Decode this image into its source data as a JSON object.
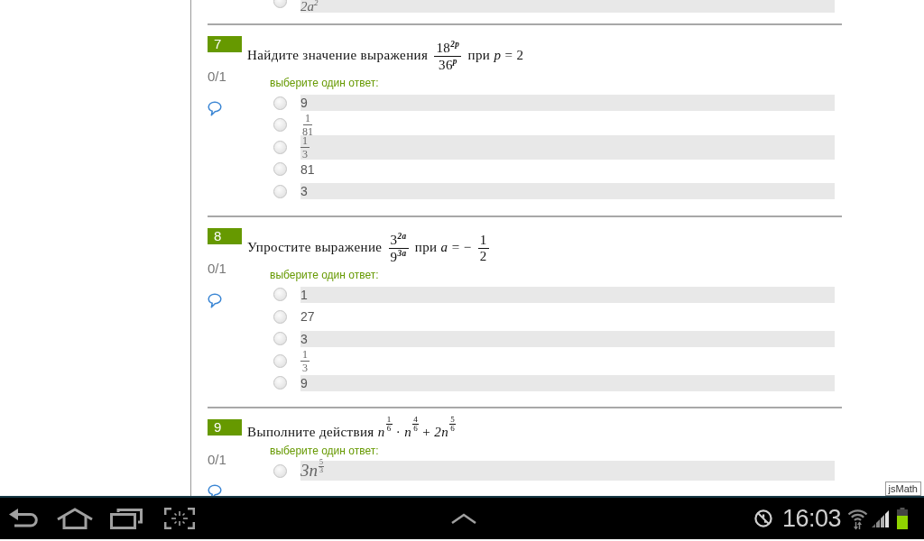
{
  "previous_question": {
    "options": [
      {
        "kind": "math",
        "text": "2a$^{2}$",
        "selected": false
      }
    ]
  },
  "questions": [
    {
      "number": "7",
      "score": "0/1",
      "prompt": [
        {
          "kind": "text",
          "text": "Найдите значение выражения"
        },
        {
          "kind": "frac",
          "num": "18$^{2p}$",
          "den": "36$^{p}$"
        },
        {
          "kind": "text",
          "text": "при *p* = 2"
        }
      ],
      "answer_prompt": "выберите один ответ:",
      "options": [
        {
          "kind": "text",
          "text": "9",
          "selected": false
        },
        {
          "kind": "frac",
          "num": "1",
          "den": "81",
          "selected": false
        },
        {
          "kind": "frac",
          "num": "1",
          "den": "3",
          "selected": false
        },
        {
          "kind": "text",
          "text": "81",
          "selected": false
        },
        {
          "kind": "text",
          "text": "3",
          "selected": false
        }
      ]
    },
    {
      "number": "8",
      "score": "0/1",
      "prompt": [
        {
          "kind": "text",
          "text": "Упростите выражение"
        },
        {
          "kind": "frac",
          "num": "3$^{2a}$",
          "den": "9$^{3a}$"
        },
        {
          "kind": "text",
          "text": "при *a* = −"
        },
        {
          "kind": "frac",
          "num": "1",
          "den": "2"
        }
      ],
      "answer_prompt": "выберите один ответ:",
      "options": [
        {
          "kind": "text",
          "text": "1",
          "selected": false
        },
        {
          "kind": "text",
          "text": "27",
          "selected": false
        },
        {
          "kind": "text",
          "text": "3",
          "selected": false
        },
        {
          "kind": "frac",
          "num": "1",
          "den": "3",
          "selected": false
        },
        {
          "kind": "text",
          "text": "9",
          "selected": false
        }
      ]
    },
    {
      "number": "9",
      "score": "0/1",
      "prompt": [
        {
          "kind": "text",
          "text": "Выполните действия"
        },
        {
          "kind": "pow",
          "base": "n",
          "num": "1",
          "den": "6"
        },
        {
          "kind": "text",
          "text": "·"
        },
        {
          "kind": "pow",
          "base": "n",
          "num": "4",
          "den": "6"
        },
        {
          "kind": "text",
          "text": "+"
        },
        {
          "kind": "pow",
          "base": "2n",
          "num": "5",
          "den": "6"
        }
      ],
      "answer_prompt": "выберите один ответ:",
      "options": [
        {
          "kind": "pow",
          "base": "3n",
          "num": "5",
          "den": "3",
          "selected": false
        }
      ]
    }
  ],
  "jsmath_button": {
    "label": "jsMath"
  },
  "status_bar": {
    "time": "16:03"
  }
}
